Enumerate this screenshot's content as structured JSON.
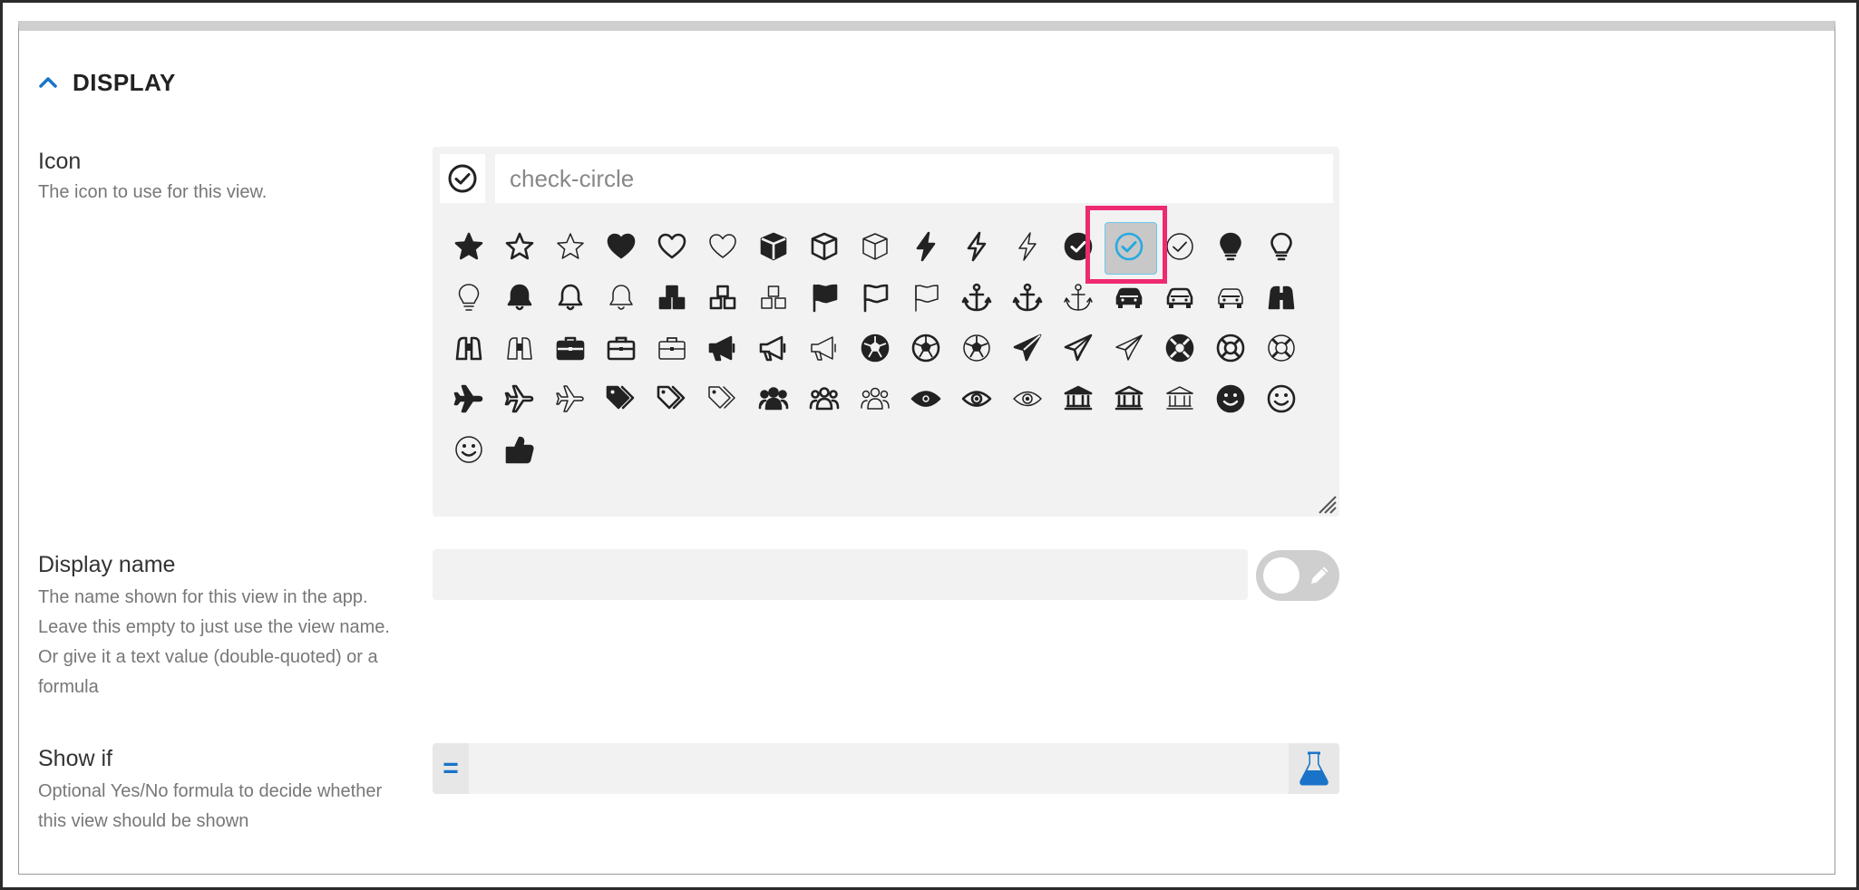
{
  "section": {
    "title": "DISPLAY",
    "icon": "chevron-up-icon"
  },
  "icon_field": {
    "label": "Icon",
    "help": "The icon to use for this view.",
    "value": "check-circle",
    "preview_icon": "check-circle-icon",
    "icons": [
      "star-solid-icon",
      "star-regular-icon",
      "star-light-icon",
      "heart-solid-icon",
      "heart-regular-icon",
      "heart-light-icon",
      "cube-solid-icon",
      "cube-regular-icon",
      "cube-light-icon",
      "bolt-solid-icon",
      "bolt-regular-icon",
      "bolt-light-icon",
      "check-circle-solid-icon",
      "check-circle-regular-icon",
      "check-circle-light-icon",
      "lightbulb-solid-icon",
      "lightbulb-regular-icon",
      "lightbulb-light-icon",
      "bell-solid-icon",
      "bell-regular-icon",
      "bell-light-icon",
      "cubes-solid-icon",
      "cubes-regular-icon",
      "cubes-light-icon",
      "flag-solid-icon",
      "flag-regular-icon",
      "flag-light-icon",
      "anchor-solid-icon",
      "anchor-regular-icon",
      "anchor-light-icon",
      "car-solid-icon",
      "car-regular-icon",
      "car-light-icon",
      "binoculars-solid-icon",
      "binoculars-regular-icon",
      "binoculars-light-icon",
      "briefcase-solid-icon",
      "briefcase-regular-icon",
      "briefcase-light-icon",
      "bullhorn-solid-icon",
      "bullhorn-regular-icon",
      "bullhorn-light-icon",
      "futbol-solid-icon",
      "futbol-regular-icon",
      "futbol-light-icon",
      "paper-plane-solid-icon",
      "paper-plane-regular-icon",
      "paper-plane-light-icon",
      "life-ring-solid-icon",
      "life-ring-regular-icon",
      "life-ring-light-icon",
      "plane-solid-icon",
      "plane-regular-icon",
      "plane-light-icon",
      "tags-solid-icon",
      "tags-regular-icon",
      "tags-light-icon",
      "users-solid-icon",
      "users-regular-icon",
      "users-light-icon",
      "eye-solid-icon",
      "eye-regular-icon",
      "eye-light-icon",
      "university-solid-icon",
      "university-regular-icon",
      "university-light-icon",
      "smile-solid-icon",
      "smile-regular-icon",
      "smile-light-icon",
      "thumbs-up-solid-icon"
    ],
    "selected_index": 13
  },
  "display_name_field": {
    "label": "Display name",
    "help": "The name shown for this view in the app. Leave this empty to just use the view name. Or give it a text value (double-quoted) or a formula",
    "value": "",
    "toggle_icon": "pencil-icon"
  },
  "show_if_field": {
    "label": "Show if",
    "help": "Optional Yes/No formula to decide whether this view should be shown",
    "prefix": "=",
    "value": "",
    "test_icon": "flask-icon"
  },
  "colors": {
    "accent": "#1a73c8",
    "highlight": "#ee2a71",
    "selected_icon": "#29a9e0"
  }
}
